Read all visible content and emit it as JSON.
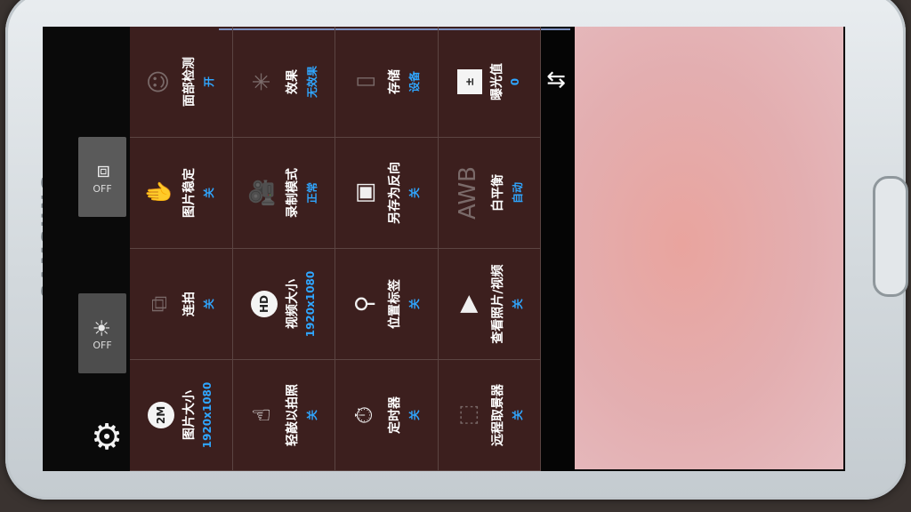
{
  "device": {
    "brand": "SAMSUNG"
  },
  "shortcuts": [
    {
      "name": "night-mode-off",
      "icon": "☀",
      "value": "OFF"
    },
    {
      "name": "burst-off",
      "icon": "⧈",
      "value": "OFF"
    }
  ],
  "settings": [
    {
      "label": "图片大小",
      "value": "1920x1080",
      "icon": "2M",
      "icon_type": "circle"
    },
    {
      "label": "连拍",
      "value": "关",
      "icon": "⧉",
      "icon_type": "dim"
    },
    {
      "label": "图片稳定",
      "value": "关",
      "icon": "✋",
      "icon_type": "dim"
    },
    {
      "label": "面部检测",
      "value": "开",
      "icon": "☺",
      "icon_type": "dim"
    },
    {
      "label": "轻敲以拍照",
      "value": "关",
      "icon": "☝",
      "icon_type": "plain"
    },
    {
      "label": "视频大小",
      "value": "1920x1080",
      "icon": "HD",
      "icon_type": "circle"
    },
    {
      "label": "录制模式",
      "value": "正常",
      "icon": "🎥",
      "icon_type": "plain"
    },
    {
      "label": "效果",
      "value": "无效果",
      "icon": "✳",
      "icon_type": "dim"
    },
    {
      "label": "定时器",
      "value": "关",
      "icon": "⏱",
      "icon_type": "plain"
    },
    {
      "label": "位置标签",
      "value": "关",
      "icon": "⚲",
      "icon_type": "plain"
    },
    {
      "label": "另存为反向",
      "value": "关",
      "icon": "▣",
      "icon_type": "plain"
    },
    {
      "label": "存储",
      "value": "设备",
      "icon": "▯",
      "icon_type": "dim"
    },
    {
      "label": "远程取景器",
      "value": "关",
      "icon": "⬚",
      "icon_type": "dim"
    },
    {
      "label": "查看照片/视频",
      "value": "关",
      "icon": "▶",
      "icon_type": "plain"
    },
    {
      "label": "白平衡",
      "value": "自动",
      "icon": "AWB",
      "icon_type": "dim"
    },
    {
      "label": "曝光值",
      "value": "0",
      "icon": "±",
      "icon_type": "square"
    }
  ],
  "icons": {
    "settings": "gear-icon",
    "switch_camera": "switch-camera-icon"
  },
  "colors": {
    "grid_bg": "#3c1f1e",
    "value_blue": "#2fa6ff",
    "preview": "#e6a7a6"
  }
}
